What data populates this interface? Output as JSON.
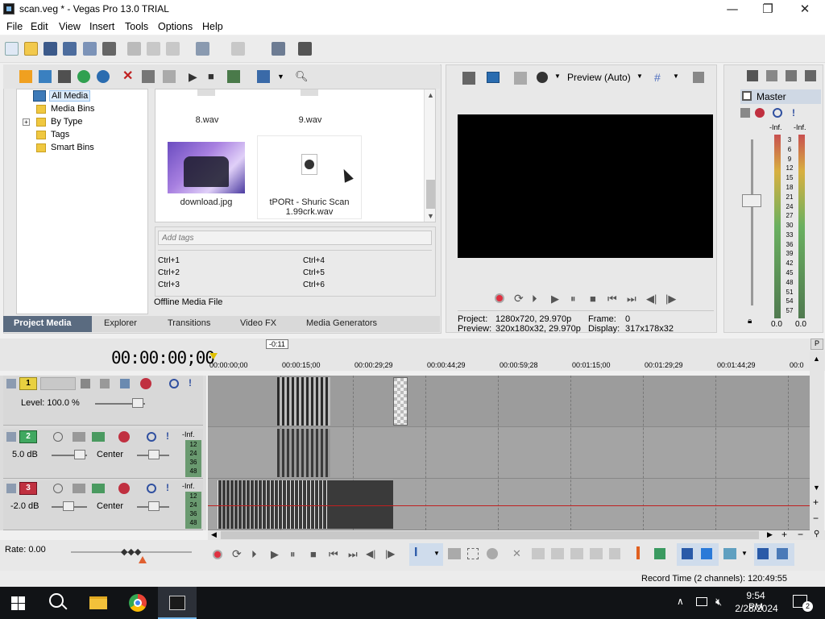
{
  "window": {
    "title": "scan.veg * - Vegas Pro 13.0 TRIAL",
    "minimize": "—",
    "maximize": "❐",
    "close": "✕"
  },
  "menu": [
    "File",
    "Edit",
    "View",
    "Insert",
    "Tools",
    "Options",
    "Help"
  ],
  "media": {
    "tree": [
      "All Media",
      "Media Bins",
      "By Type",
      "Tags",
      "Smart Bins"
    ],
    "tree_expander": "+",
    "files": {
      "top_left": "8.wav",
      "top_right": "9.wav",
      "image_name": "download.jpg",
      "selected_name": "tPORt - Shuric Scan 1.99crk.wav"
    },
    "tags_placeholder": "Add tags",
    "shortcuts": [
      "Ctrl+1",
      "Ctrl+2",
      "Ctrl+3",
      "Ctrl+4",
      "Ctrl+5",
      "Ctrl+6"
    ],
    "status": "Offline Media File"
  },
  "bottom_tabs": [
    "Project Media",
    "Explorer",
    "Transitions",
    "Video FX",
    "Media Generators"
  ],
  "preview": {
    "mode": "Preview (Auto)",
    "project_label": "Project:",
    "project_value": "1280x720, 29.970p",
    "preview_label": "Preview:",
    "preview_value": "320x180x32, 29.970p",
    "frame_label": "Frame:",
    "frame_value": "0",
    "display_label": "Display:",
    "display_value": "317x178x32"
  },
  "master": {
    "title": "Master",
    "inf_left": "-Inf.",
    "inf_right": "-Inf.",
    "scale": [
      "3",
      "6",
      "9",
      "12",
      "15",
      "18",
      "21",
      "24",
      "27",
      "30",
      "33",
      "36",
      "39",
      "42",
      "45",
      "48",
      "51",
      "54",
      "57"
    ],
    "val_left": "0.0",
    "val_right": "0.0"
  },
  "timeline": {
    "time": "00:00:00;00",
    "marker": "-0:11",
    "ruler": [
      "00:00:00;00",
      "00:00:15;00",
      "00:00:29;29",
      "00:00:44;29",
      "00:00:59;28",
      "00:01:15;00",
      "00:01:29;29",
      "00:01:44;29",
      "00:0"
    ],
    "tracks": [
      {
        "num": "1",
        "label": "Level: 100.0 %",
        "color": "#e8d040"
      },
      {
        "num": "2",
        "label": "5.0 dB",
        "pan": "Center",
        "color": "#40a860",
        "inf": "-Inf.",
        "meter": [
          "12",
          "24",
          "36",
          "48"
        ]
      },
      {
        "num": "3",
        "label": "-2.0 dB",
        "pan": "Center",
        "color": "#c03040",
        "inf": "-Inf.",
        "meter": [
          "12",
          "24",
          "36",
          "48"
        ]
      }
    ],
    "rate": "Rate: 0.00",
    "record_time": "Record Time (2 channels): 120:49:55"
  },
  "taskbar": {
    "time": "9:54 PM",
    "date": "2/28/2024",
    "notifications": "2"
  },
  "colors": {
    "accent": "#3a7bd5",
    "video_track": "#e8d040",
    "audio_track_2": "#40a860",
    "audio_track_3": "#c03040"
  }
}
